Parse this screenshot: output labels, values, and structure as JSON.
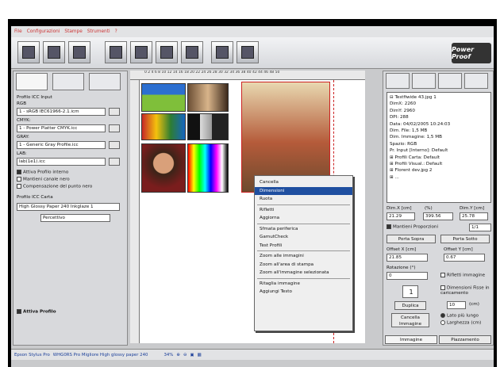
{
  "menu": [
    "File",
    "Configurazioni",
    "Stampe",
    "Strumenti",
    "?"
  ],
  "toolbar_icons": [
    "new-page-icon",
    "open-icon",
    "save-icon",
    "image-icon",
    "layout-icon",
    "print-preview-icon",
    "print-icon",
    "scanner-icon",
    "settings-icon"
  ],
  "logo_text": "Power Proof",
  "left": {
    "section_title": "Profilo ICC Input",
    "rgb_label": "RGB",
    "rgb_value": "1 - sRGB IEC61966-2.1.icm",
    "cmyk_label": "CMYK:",
    "cmyk_value": "1 - Power Platter CMYK.icc",
    "gray_label": "GRAY:",
    "gray_value": "1 - Generic Gray Profile.icc",
    "lab_label": "LAB:",
    "lab_value": "lab(1e1).icc",
    "chk_internal": "Attiva Profilo interno",
    "chk_black": "Mantieni canale nero",
    "chk_comp": "Compensazione del punto nero",
    "card_title": "Profilo ICC Carta",
    "card_value": "High Glossy Paper 240 Inkglaze 1",
    "intent_value": "Percettivo",
    "active_label": "Attiva Profilo"
  },
  "ruler_numbers": "0 2 4 6 8 10 12 14 16 18 20 22 24 26 28 30 32 34 36 38 40 42 44 46 48 50",
  "context_menu": [
    {
      "label": "Cancella",
      "hl": false
    },
    {
      "label": "Dimensioni",
      "hl": true
    },
    {
      "label": "Ruota",
      "hl": false
    },
    {
      "sep": true
    },
    {
      "label": "Rifletti",
      "hl": false
    },
    {
      "label": "Aggiorna",
      "hl": false
    },
    {
      "sep": true
    },
    {
      "label": "Sfmata periferica",
      "hl": false
    },
    {
      "label": "GamutCheck",
      "hl": false
    },
    {
      "label": "Test Profili",
      "hl": false
    },
    {
      "sep": true
    },
    {
      "label": "Zoom alle immagini",
      "hl": false
    },
    {
      "label": "Zoom all'area di stampa",
      "hl": false
    },
    {
      "label": "Zoom all'immagine selezionata",
      "hl": false
    },
    {
      "sep": true
    },
    {
      "label": "Ritaglia immagine",
      "hl": false
    },
    {
      "label": "Aggiungi Testo",
      "hl": false
    }
  ],
  "right": {
    "tree": [
      "⊟ Testfiwide 43.jpg 1",
      "    DimX: 2260",
      "    DimY: 2960",
      "    DPI: 288",
      "    Data: 04/02/2005 10:24:03",
      "    Dim. File: 1,5 MB",
      "    Dim. Immagine: 1,5 MB",
      "    Spazio: RGB",
      "    Pr. Input [Interno]: Default",
      "  ⊞ Profili Carta: Default",
      "  ⊞ Profili Visual.: Default",
      "⊞ Florent dev.jpg 2",
      "⊞ ..."
    ],
    "dimx_label": "Dim.X [cm]",
    "dimx_value": "21.29",
    "perc_label": "(%)",
    "perc_value": "399.56",
    "dimy_label": "Dim.Y [cm]",
    "dimy_value": "25.78",
    "keep_prop": "Mantieni Proporzioni",
    "ratio_value": "1/1",
    "btn_top": "Porta Sopra",
    "btn_bottom": "Porta Sotto",
    "offx_label": "Offset X [cm]",
    "offx_value": "21.85",
    "offy_label": "Offset Y [cm]",
    "offy_value": "0.67",
    "rot_label": "Rotazione (°)",
    "rot_value": "0",
    "reflect_label": "Rifletti immagine",
    "copies_value": "1",
    "fixed_dims": "Dimensioni Fisse in caricamento",
    "dup_btn": "Duplica",
    "dim_value": "10",
    "dim_unit": "(cm)",
    "del_btn": "Cancella Immagine",
    "long_side": "Lato più lungo",
    "width_opt": "Larghezza (cm)",
    "tab_img": "Immagine",
    "tab_place": "Piazzamento"
  },
  "status": {
    "printer": "Epson Stylus Pro",
    "paper": "WHG0RS Pro Migliore High glossy paper 240",
    "zoom": "34%"
  }
}
